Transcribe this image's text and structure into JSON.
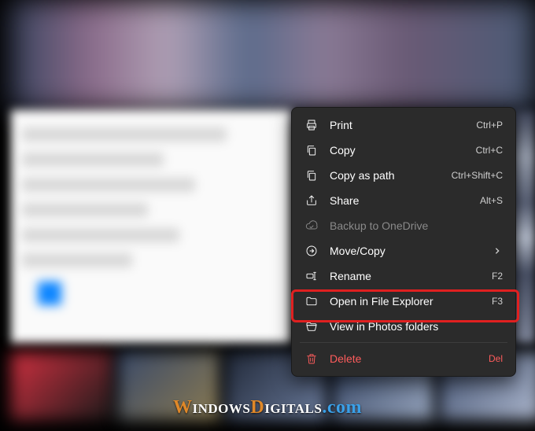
{
  "menu": {
    "items": [
      {
        "key": "print",
        "label": "Print",
        "shortcut": "Ctrl+P"
      },
      {
        "key": "copy",
        "label": "Copy",
        "shortcut": "Ctrl+C"
      },
      {
        "key": "copypath",
        "label": "Copy as path",
        "shortcut": "Ctrl+Shift+C"
      },
      {
        "key": "share",
        "label": "Share",
        "shortcut": "Alt+S"
      },
      {
        "key": "backup",
        "label": "Backup to OneDrive",
        "shortcut": ""
      },
      {
        "key": "movecopy",
        "label": "Move/Copy",
        "shortcut": ""
      },
      {
        "key": "rename",
        "label": "Rename",
        "shortcut": "F2"
      },
      {
        "key": "explorer",
        "label": "Open in File Explorer",
        "shortcut": "F3"
      },
      {
        "key": "photos",
        "label": "View in Photos folders",
        "shortcut": ""
      },
      {
        "key": "delete",
        "label": "Delete",
        "shortcut": "Del"
      }
    ]
  },
  "watermark": {
    "w1": "W",
    "w2": "indows",
    "w3": "D",
    "w4": "igitals",
    "w5": ".com"
  },
  "colors": {
    "menu_bg": "#2b2b2b",
    "delete": "#ff5c5c",
    "highlight": "#e02020"
  }
}
